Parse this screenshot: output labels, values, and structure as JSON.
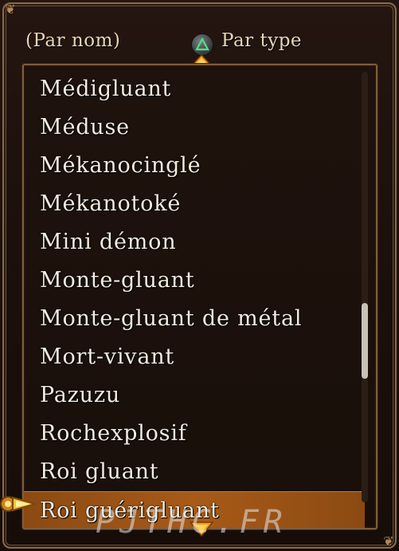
{
  "header": {
    "tab_by_name": "(Par nom)",
    "tab_by_type": "Par type",
    "triangle_button_icon": "triangle-button-icon"
  },
  "list": {
    "items": [
      "Médigluant",
      "Méduse",
      "Mékanocinglé",
      "Mékanotoké",
      "Mini démon",
      "Monte-gluant",
      "Monte-gluant de métal",
      "Mort-vivant",
      "Pazuzu",
      "Rochexplosif",
      "Roi gluant",
      "Roi guérigluant"
    ],
    "selected_index": 11
  },
  "watermark": "PJTHC.FR",
  "colors": {
    "accent_selection": "#a85a18",
    "frame_gold": "#8a6a45",
    "text": "#f2ecdf"
  }
}
